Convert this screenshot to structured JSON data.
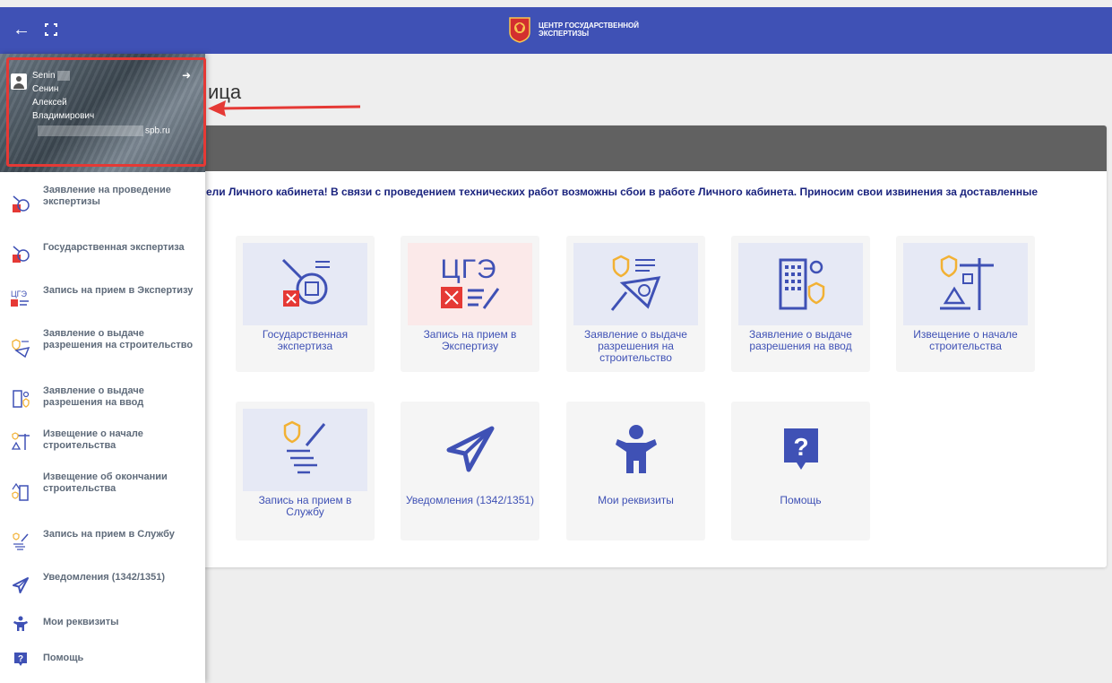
{
  "topbar": {
    "back_icon": "arrow-left-icon",
    "fullscreen_icon": "fullscreen-icon",
    "brand_line1": "ЦЕНТР ГОСУДАРСТВЕННОЙ",
    "brand_line2": "ЭКСПЕРТИЗЫ",
    "color": "#3f51b5"
  },
  "profile": {
    "login": "Senin",
    "last_name": "Сенин",
    "first_name": "Алексей",
    "middle_name": "Владимирович",
    "email_suffix": "spb.ru",
    "highlight_color": "#e53935"
  },
  "main": {
    "title_visible": "ица",
    "notice": "ели Личного кабинета! В связи с проведением технических работ возможны сбои в работе Личного кабинета.  Приносим свои извинения за доставленные"
  },
  "tiles": [
    {
      "label": "Государственная экспертиза"
    },
    {
      "label": "Запись на прием в Экспертизу",
      "art_text": "ЦГЭ"
    },
    {
      "label": "Заявление о выдаче разрешения на строительство"
    },
    {
      "label": "Заявление о выдаче разрешения на ввод"
    },
    {
      "label": "Извещение о начале строительства"
    },
    {
      "label": "Запись на прием в Службу"
    },
    {
      "label": "Уведомления (1342/1351)"
    },
    {
      "label": "Мои реквизиты"
    },
    {
      "label": "Помощь"
    }
  ],
  "sidebar": {
    "items": [
      {
        "label": "Заявление на проведение экспертизы"
      },
      {
        "label": "Государственная экспертиза"
      },
      {
        "label": "Запись на прием в Экспертизу"
      },
      {
        "label": "Заявление о выдаче разрешения на строительство"
      },
      {
        "label": "Заявление о выдаче разрешения на ввод"
      },
      {
        "label": "Извещение о начале строительства"
      },
      {
        "label": "Извещение об окончании строительства"
      },
      {
        "label": "Запись на прием в Службу"
      },
      {
        "label": "Уведомления (1342/1351)"
      },
      {
        "label": "Мои реквизиты"
      },
      {
        "label": "Помощь"
      }
    ]
  }
}
